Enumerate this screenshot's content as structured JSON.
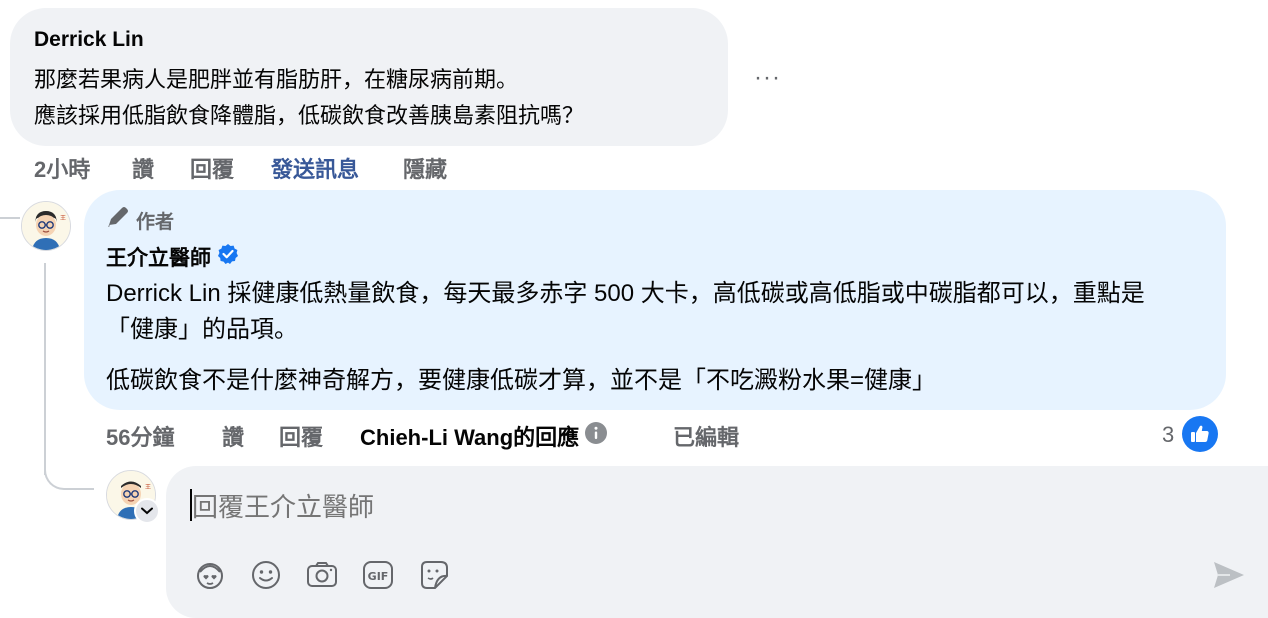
{
  "comment": {
    "author": "Derrick Lin",
    "lines": [
      "那麼若果病人是肥胖並有脂肪肝，在糖尿病前期。",
      "應該採用低脂飲食降體脂，低碳飲食改善胰島素阻抗嗎？"
    ],
    "more": "···",
    "actions": {
      "time": "2小時",
      "like": "讚",
      "reply": "回覆",
      "send_message": "發送訊息",
      "hide": "隱藏"
    }
  },
  "reply": {
    "badge": "作者",
    "author": "王介立醫師",
    "paragraphs": [
      "Derrick Lin 採健康低熱量飲食，每天最多赤字 500 大卡，高低碳或高低脂或中碳脂都可以，重點是「健康」的品項。",
      "低碳飲食不是什麼神奇解方，要健康低碳才算，並不是「不吃澱粉水果=健康」"
    ],
    "actions": {
      "time": "56分鐘",
      "like": "讚",
      "reply": "回覆",
      "responder": "Chieh-Li Wang的回應",
      "edited": "已編輯"
    },
    "reaction_count": "3"
  },
  "composer": {
    "placeholder": "回覆王介立醫師"
  },
  "colors": {
    "accent": "#1877f2",
    "bubble": "#f0f2f5",
    "author_bubble": "#e7f3ff",
    "muted": "#65676b"
  },
  "icons": [
    "more-icon",
    "pencil-icon",
    "verified-icon",
    "info-icon",
    "like-icon",
    "chevron-down-icon",
    "avatar-sticker-icon",
    "emoji-icon",
    "camera-icon",
    "gif-icon",
    "sticker-icon",
    "send-icon"
  ]
}
